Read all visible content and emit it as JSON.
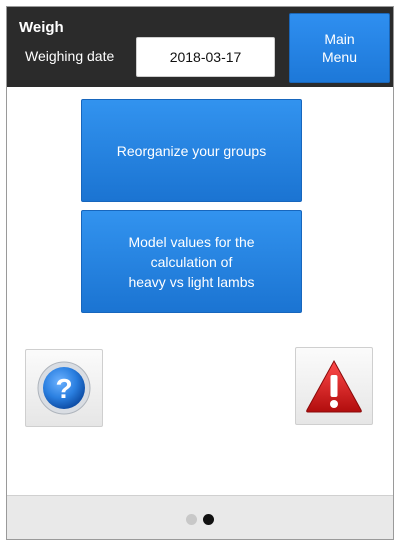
{
  "header": {
    "title": "Weigh",
    "date_label": "Weighing date",
    "date_value": "2018-03-17",
    "main_menu_label": "Main\nMenu"
  },
  "actions": [
    {
      "label": "Reorganize your groups"
    },
    {
      "label": "Model values for the\ncalculation of\nheavy vs light lambs"
    }
  ],
  "icons": {
    "help": "help-question-icon",
    "alert": "warning-exclamation-icon"
  },
  "pager": {
    "pages": 2,
    "active_index": 1
  },
  "colors": {
    "header_bg": "#2b2b2b",
    "button_blue": "#1d78d8",
    "alert_red": "#d81f1f",
    "help_blue": "#1f6fd0"
  }
}
